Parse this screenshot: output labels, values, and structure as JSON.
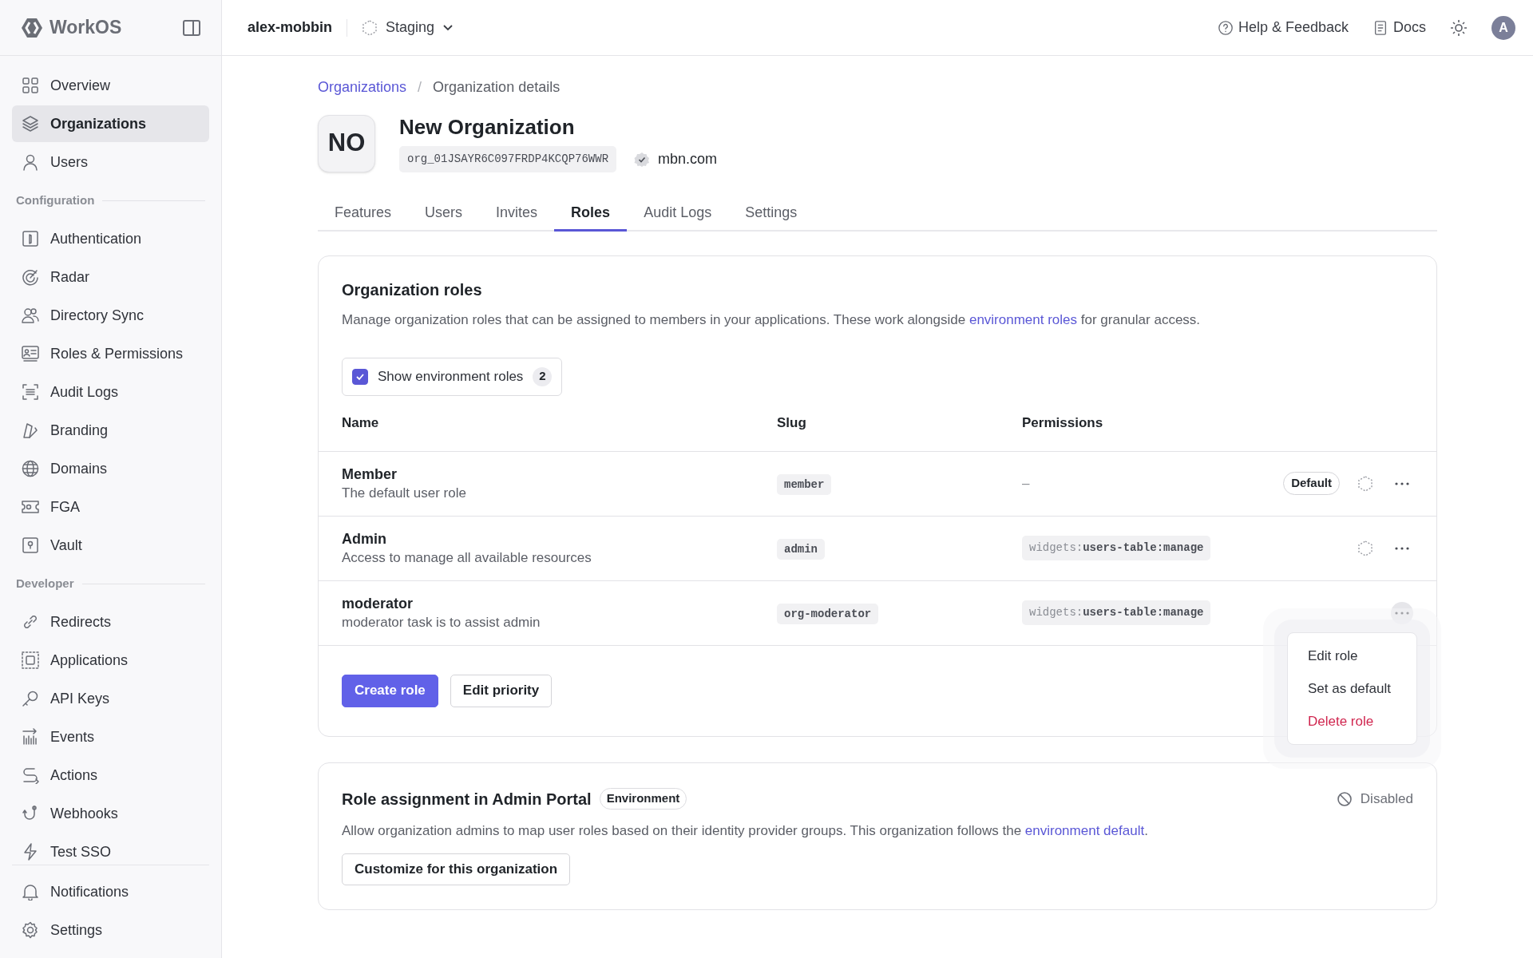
{
  "brand": {
    "name": "WorkOS"
  },
  "sidebar": {
    "groups": [
      {
        "items": [
          {
            "label": "Overview",
            "selected": false
          },
          {
            "label": "Organizations",
            "selected": true
          },
          {
            "label": "Users",
            "selected": false
          }
        ]
      },
      {
        "heading": "Configuration",
        "items": [
          {
            "label": "Authentication",
            "selected": false
          },
          {
            "label": "Radar",
            "selected": false
          },
          {
            "label": "Directory Sync",
            "selected": false
          },
          {
            "label": "Roles & Permissions",
            "selected": false
          },
          {
            "label": "Audit Logs",
            "selected": false
          },
          {
            "label": "Branding",
            "selected": false
          },
          {
            "label": "Domains",
            "selected": false
          },
          {
            "label": "FGA",
            "selected": false
          },
          {
            "label": "Vault",
            "selected": false
          }
        ]
      },
      {
        "heading": "Developer",
        "items": [
          {
            "label": "Redirects",
            "selected": false
          },
          {
            "label": "Applications",
            "selected": false
          },
          {
            "label": "API Keys",
            "selected": false
          },
          {
            "label": "Events",
            "selected": false
          },
          {
            "label": "Actions",
            "selected": false
          },
          {
            "label": "Webhooks",
            "selected": false
          },
          {
            "label": "Test SSO",
            "selected": false
          }
        ]
      }
    ],
    "footer": [
      {
        "label": "Notifications",
        "selected": false
      },
      {
        "label": "Settings",
        "selected": false
      }
    ]
  },
  "topbar": {
    "workspace": "alex-mobbin",
    "environment": "Staging",
    "links": [
      {
        "label": "Help & Feedback"
      },
      {
        "label": "Docs"
      }
    ],
    "avatar": "A"
  },
  "breadcrumb": [
    {
      "label": "Organizations",
      "kind": "link"
    },
    {
      "label": "/",
      "kind": "separator"
    },
    {
      "label": "Organization details",
      "kind": "current"
    }
  ],
  "organization": {
    "initials": "NO",
    "name": "New Organization",
    "id": "org_01JSAYR6C097FRDP4KCQP76WWR",
    "domain": "mbn.com"
  },
  "tabs": [
    {
      "label": "Features",
      "selected": false
    },
    {
      "label": "Users",
      "selected": false
    },
    {
      "label": "Invites",
      "selected": false
    },
    {
      "label": "Roles",
      "selected": true
    },
    {
      "label": "Audit Logs",
      "selected": false
    },
    {
      "label": "Settings",
      "selected": false
    }
  ],
  "roles_card": {
    "title": "Organization roles",
    "description_before": "Manage organization roles that can be assigned to members in your applications. These work alongside ",
    "description_link": "environment roles",
    "description_after": " for granular access.",
    "filter": {
      "label": "Show environment roles",
      "checked": true,
      "count": "2"
    },
    "columns": [
      "Name",
      "Slug",
      "Permissions"
    ],
    "rows": [
      {
        "name": "Member",
        "description": "The default user role",
        "slug": "member",
        "permission": {
          "kind": "none",
          "text": "–"
        },
        "badge": "Default",
        "environment_icon": true,
        "menu_open": false
      },
      {
        "name": "Admin",
        "description": "Access to manage all available resources",
        "slug": "admin",
        "permission": {
          "kind": "code",
          "scope": "widgets:",
          "action": "users-table:manage"
        },
        "environment_icon": true,
        "menu_open": false
      },
      {
        "name": "moderator",
        "description": "moderator task is to assist admin",
        "slug": "org-moderator",
        "permission": {
          "kind": "code",
          "scope": "widgets:",
          "action": "users-table:manage"
        },
        "environment_icon": false,
        "menu_open": true
      }
    ],
    "buttons": [
      {
        "label": "Create role",
        "kind": "primary"
      },
      {
        "label": "Edit priority",
        "kind": "secondary"
      }
    ]
  },
  "row_menu": [
    {
      "label": "Edit role",
      "kind": "normal"
    },
    {
      "label": "Set as default",
      "kind": "normal"
    },
    {
      "label": "Delete role",
      "kind": "danger"
    }
  ],
  "assignment_card": {
    "title": "Role assignment in Admin Portal",
    "badge": "Environment",
    "status": "Disabled",
    "description_before": "Allow organization admins to map user roles based on their identity provider groups. This organization follows the ",
    "description_link": "environment default",
    "description_after": ".",
    "button": "Customize for this organization"
  }
}
